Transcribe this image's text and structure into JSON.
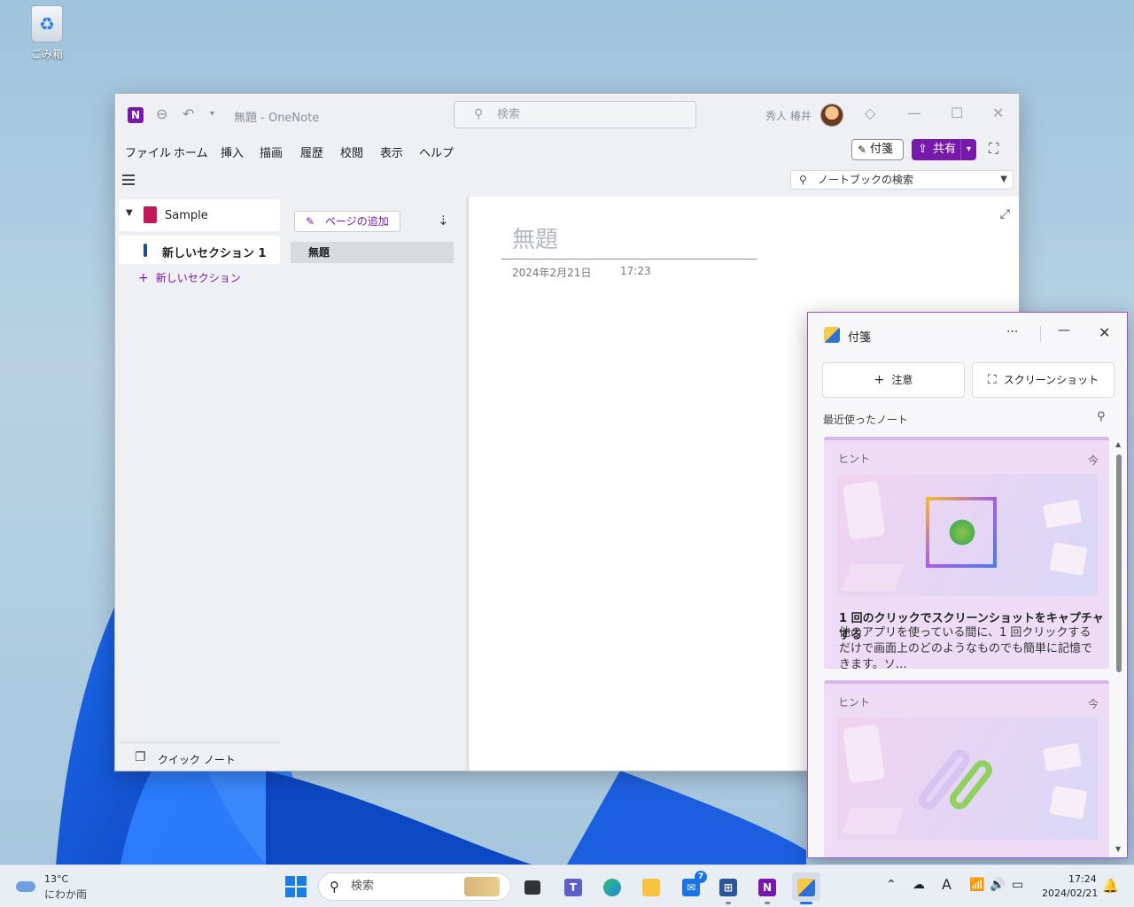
{
  "desktop": {
    "recycle_bin_label": "ごみ箱"
  },
  "onenote": {
    "window_title": "無題  -  OneNote",
    "search_placeholder": "検索",
    "user_name": "秀人 椿井",
    "menu": [
      "ファイル",
      "ホーム",
      "挿入",
      "描画",
      "履歴",
      "校閲",
      "表示",
      "ヘルプ"
    ],
    "sticky_notes_label": "付箋",
    "share_label": "共有",
    "notebook_search_placeholder": "ノートブックの検索",
    "notebook_name": "Sample",
    "section_name": "新しいセクション 1",
    "add_section_label": "新しいセクション",
    "quick_note_label": "クイック ノート",
    "add_page_label": "ページの追加",
    "pages": [
      "無題"
    ],
    "page": {
      "title": "無題",
      "date": "2024年2月21日",
      "time": "17:23"
    }
  },
  "sticky_notes": {
    "title": "付箋",
    "new_note_label": "注意",
    "screenshot_label": "スクリーンショット",
    "recent_label": "最近使ったノート",
    "cards": [
      {
        "tag": "ヒント",
        "time": "今",
        "title": "1 回のクリックでスクリーンショットをキャプチャする",
        "body": "他のアプリを使っている間に、1 回クリックするだけで画面上のどのようなものでも簡単に記憶できます。ソ…"
      },
      {
        "tag": "ヒント",
        "time": "今",
        "title": "",
        "body": ""
      }
    ]
  },
  "taskbar": {
    "weather_temp": "13°C",
    "weather_desc": "にわか雨",
    "search_placeholder": "検索",
    "mail_badge": "7",
    "clock_time": "17:24",
    "clock_date": "2024/02/21"
  },
  "colors": {
    "accent": "#7719aa",
    "sticky_card": "#eedcf6",
    "taskbar": "#e8eef4"
  }
}
